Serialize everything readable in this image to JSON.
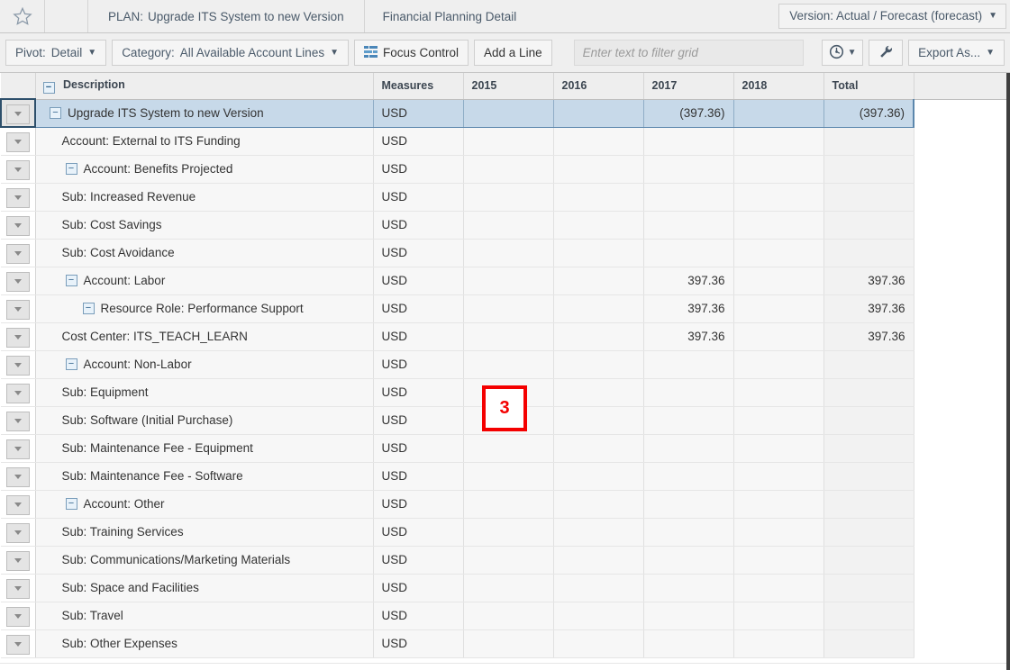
{
  "header": {
    "star_icon": "star-icon",
    "plan_label": "PLAN:",
    "plan_value": "Upgrade ITS System to new Version",
    "tab_label": "Financial Planning Detail",
    "version_text": "Version: Actual / Forecast (forecast)",
    "caret": "▼"
  },
  "toolbar": {
    "pivot_label": "Pivot:",
    "pivot_value": "Detail",
    "category_label": "Category:",
    "category_value": "All Available Account Lines",
    "focus_control_label": "Focus Control",
    "add_a_line_label": "Add a Line",
    "filter_placeholder": "Enter text to filter grid",
    "filter_value": "",
    "history_icon": "clock-icon",
    "tools_icon": "wrench-icon",
    "export_label": "Export As...",
    "caret": "▼"
  },
  "grid": {
    "columns": [
      {
        "key": "handle",
        "label": ""
      },
      {
        "key": "desc",
        "label": "Description"
      },
      {
        "key": "meas",
        "label": "Measures"
      },
      {
        "key": "y2015",
        "label": "2015"
      },
      {
        "key": "y2016",
        "label": "2016"
      },
      {
        "key": "y2017",
        "label": "2017"
      },
      {
        "key": "y2018",
        "label": "2018"
      },
      {
        "key": "total",
        "label": "Total"
      }
    ],
    "collapse_glyph": "−",
    "rows": [
      {
        "level": 0,
        "node": true,
        "desc": "Upgrade ITS System to new Version",
        "meas": "USD",
        "y2015": "",
        "y2016": "",
        "y2017": "(397.36)",
        "y2018": "",
        "total": "(397.36)",
        "selected": true
      },
      {
        "level": 1,
        "node": false,
        "desc": "Account: External to ITS Funding",
        "meas": "USD",
        "y2015": "",
        "y2016": "",
        "y2017": "",
        "y2018": "",
        "total": ""
      },
      {
        "level": 1,
        "node": true,
        "desc": "Account: Benefits Projected",
        "meas": "USD",
        "y2015": "",
        "y2016": "",
        "y2017": "",
        "y2018": "",
        "total": ""
      },
      {
        "level": 2,
        "node": false,
        "desc": "Sub: Increased Revenue",
        "meas": "USD",
        "y2015": "",
        "y2016": "",
        "y2017": "",
        "y2018": "",
        "total": ""
      },
      {
        "level": 2,
        "node": false,
        "desc": "Sub: Cost Savings",
        "meas": "USD",
        "y2015": "",
        "y2016": "",
        "y2017": "",
        "y2018": "",
        "total": ""
      },
      {
        "level": 2,
        "node": false,
        "desc": "Sub: Cost Avoidance",
        "meas": "USD",
        "y2015": "",
        "y2016": "",
        "y2017": "",
        "y2018": "",
        "total": ""
      },
      {
        "level": 1,
        "node": true,
        "desc": "Account: Labor",
        "meas": "USD",
        "y2015": "",
        "y2016": "",
        "y2017": "397.36",
        "y2018": "",
        "total": "397.36"
      },
      {
        "level": 2,
        "node": true,
        "desc": "Resource Role: Performance Support",
        "meas": "USD",
        "y2015": "",
        "y2016": "",
        "y2017": "397.36",
        "y2018": "",
        "total": "397.36"
      },
      {
        "level": 3,
        "node": false,
        "desc": "Cost Center: ITS_TEACH_LEARN",
        "meas": "USD",
        "y2015": "",
        "y2016": "",
        "y2017": "397.36",
        "y2018": "",
        "total": "397.36"
      },
      {
        "level": 1,
        "node": true,
        "desc": "Account: Non-Labor",
        "meas": "USD",
        "y2015": "",
        "y2016": "",
        "y2017": "",
        "y2018": "",
        "total": ""
      },
      {
        "level": 2,
        "node": false,
        "desc": "Sub: Equipment",
        "meas": "USD",
        "y2015": "",
        "y2016": "",
        "y2017": "",
        "y2018": "",
        "total": ""
      },
      {
        "level": 2,
        "node": false,
        "desc": "Sub: Software (Initial Purchase)",
        "meas": "USD",
        "y2015": "",
        "y2016": "",
        "y2017": "",
        "y2018": "",
        "total": ""
      },
      {
        "level": 2,
        "node": false,
        "desc": "Sub: Maintenance Fee - Equipment",
        "meas": "USD",
        "y2015": "",
        "y2016": "",
        "y2017": "",
        "y2018": "",
        "total": ""
      },
      {
        "level": 2,
        "node": false,
        "desc": "Sub: Maintenance Fee - Software",
        "meas": "USD",
        "y2015": "",
        "y2016": "",
        "y2017": "",
        "y2018": "",
        "total": ""
      },
      {
        "level": 1,
        "node": true,
        "desc": "Account: Other",
        "meas": "USD",
        "y2015": "",
        "y2016": "",
        "y2017": "",
        "y2018": "",
        "total": ""
      },
      {
        "level": 2,
        "node": false,
        "desc": "Sub: Training Services",
        "meas": "USD",
        "y2015": "",
        "y2016": "",
        "y2017": "",
        "y2018": "",
        "total": ""
      },
      {
        "level": 2,
        "node": false,
        "desc": "Sub: Communications/Marketing Materials",
        "meas": "USD",
        "y2015": "",
        "y2016": "",
        "y2017": "",
        "y2018": "",
        "total": ""
      },
      {
        "level": 2,
        "node": false,
        "desc": "Sub: Space and Facilities",
        "meas": "USD",
        "y2015": "",
        "y2016": "",
        "y2017": "",
        "y2018": "",
        "total": ""
      },
      {
        "level": 2,
        "node": false,
        "desc": "Sub: Travel",
        "meas": "USD",
        "y2015": "",
        "y2016": "",
        "y2017": "",
        "y2018": "",
        "total": ""
      },
      {
        "level": 2,
        "node": false,
        "desc": "Sub: Other Expenses",
        "meas": "USD",
        "y2015": "",
        "y2016": "",
        "y2017": "",
        "y2018": "",
        "total": ""
      }
    ]
  },
  "annotation": {
    "label": "3",
    "color": "#f40000"
  },
  "colors": {
    "chrome": "#efefef",
    "selected_row": "#c7d9e9",
    "row_bg": "#f7f7f7",
    "header_bg": "#eeeeee",
    "link_text": "#4a5a6a",
    "annotation": "#f40000"
  }
}
